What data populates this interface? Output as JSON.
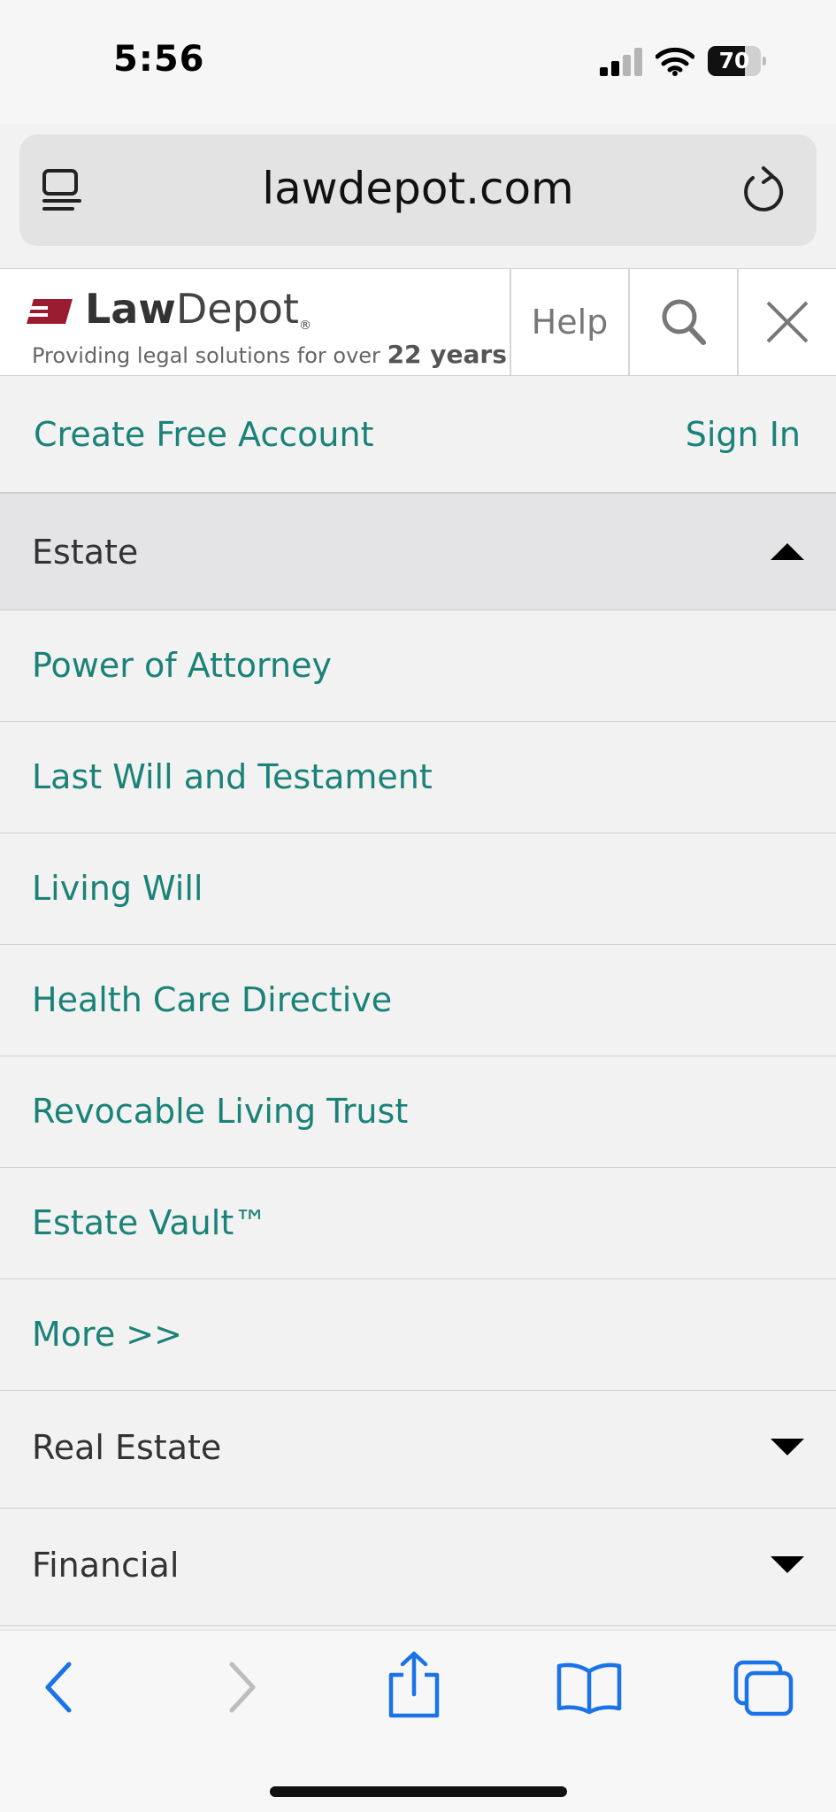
{
  "status_bar": {
    "time": "5:56",
    "battery": "70",
    "battery_level": 0.7
  },
  "browser": {
    "url": "lawdepot.com"
  },
  "header": {
    "brand_bold": "Law",
    "brand_rest": "Depot",
    "brand_mark": "®",
    "tagline": "Providing legal solutions for over",
    "tagline_years": "22 years",
    "help_label": "Help"
  },
  "account": {
    "create_label": "Create Free Account",
    "signin_label": "Sign In"
  },
  "menu": {
    "open_section": "Estate",
    "items": [
      {
        "label": "Power of Attorney"
      },
      {
        "label": "Last Will and Testament"
      },
      {
        "label": "Living Will"
      },
      {
        "label": "Health Care Directive"
      },
      {
        "label": "Revocable Living Trust"
      },
      {
        "label": "Estate Vault™"
      },
      {
        "label": "More >>"
      }
    ],
    "closed_sections": [
      {
        "label": "Real Estate"
      },
      {
        "label": "Financial"
      }
    ]
  },
  "colors": {
    "accent": "#1a8277",
    "brand_red": "#9b1b30",
    "ios_blue": "#1a73e8"
  },
  "icons": {
    "reader": "reader-icon",
    "reload": "reload-icon",
    "search": "search-icon",
    "close": "close-icon",
    "back": "back-icon",
    "forward": "forward-icon",
    "share": "share-icon",
    "bookmarks": "bookmarks-icon",
    "tabs": "tabs-icon"
  }
}
